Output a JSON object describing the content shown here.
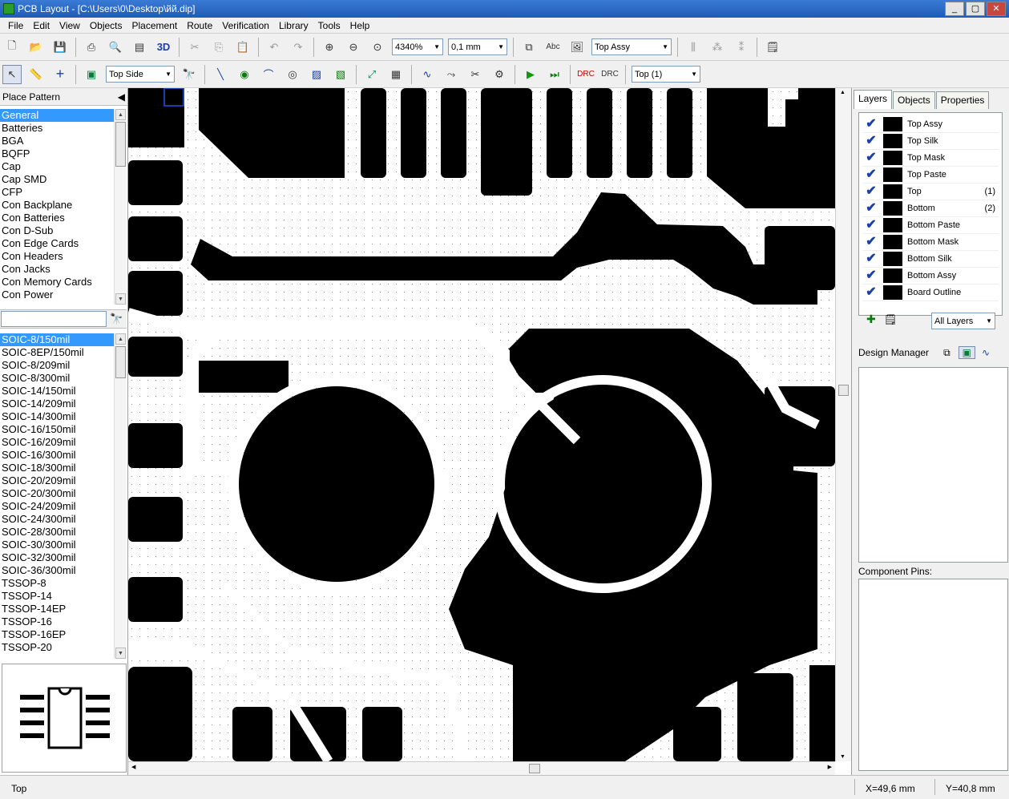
{
  "window": {
    "title": "PCB Layout - [C:\\Users\\0\\Desktop\\йй.dip]"
  },
  "menu": [
    "File",
    "Edit",
    "View",
    "Objects",
    "Placement",
    "Route",
    "Verification",
    "Library",
    "Tools",
    "Help"
  ],
  "toolbar1": {
    "zoom": "4340%",
    "grid": "0,1 mm",
    "view_layer": "Top Assy",
    "btn_3d": "3D"
  },
  "toolbar2": {
    "side": "Top Side",
    "route_layer": "Top (1)"
  },
  "left_panel": {
    "header": "Place Pattern",
    "categories": [
      "General",
      "Batteries",
      "BGA",
      "BQFP",
      "Cap",
      "Cap SMD",
      "CFP",
      "Con Backplane",
      "Con Batteries",
      "Con D-Sub",
      "Con Edge Cards",
      "Con Headers",
      "Con Jacks",
      "Con Memory Cards",
      "Con Power"
    ],
    "selected_category": 0,
    "search_value": "",
    "patterns": [
      "SOIC-8/150mil",
      "SOIC-8EP/150mil",
      "SOIC-8/209mil",
      "SOIC-8/300mil",
      "SOIC-14/150mil",
      "SOIC-14/209mil",
      "SOIC-14/300mil",
      "SOIC-16/150mil",
      "SOIC-16/209mil",
      "SOIC-16/300mil",
      "SOIC-18/300mil",
      "SOIC-20/209mil",
      "SOIC-20/300mil",
      "SOIC-24/209mil",
      "SOIC-24/300mil",
      "SOIC-28/300mil",
      "SOIC-30/300mil",
      "SOIC-32/300mil",
      "SOIC-36/300mil",
      "TSSOP-8",
      "TSSOP-14",
      "TSSOP-14EP",
      "TSSOP-16",
      "TSSOP-16EP",
      "TSSOP-20"
    ],
    "selected_pattern": 0
  },
  "right_panel": {
    "tabs": [
      "Layers",
      "Objects",
      "Properties"
    ],
    "active_tab": 0,
    "layers": [
      {
        "name": "Top Assy",
        "num": ""
      },
      {
        "name": "Top Silk",
        "num": ""
      },
      {
        "name": "Top Mask",
        "num": ""
      },
      {
        "name": "Top Paste",
        "num": ""
      },
      {
        "name": "Top",
        "num": "(1)"
      },
      {
        "name": "Bottom",
        "num": "(2)"
      },
      {
        "name": "Bottom Paste",
        "num": ""
      },
      {
        "name": "Bottom Mask",
        "num": ""
      },
      {
        "name": "Bottom Silk",
        "num": ""
      },
      {
        "name": "Bottom Assy",
        "num": ""
      },
      {
        "name": "Board Outline",
        "num": ""
      }
    ],
    "layer_filter": "All Layers",
    "design_manager": "Design Manager",
    "component_pins": "Component Pins:"
  },
  "status": {
    "layer": "Top",
    "x": "X=49,6 mm",
    "y": "Y=40,8 mm"
  },
  "colors": {
    "copper": "#000000",
    "board": "#ffffff",
    "selection": "#3399ff",
    "check": "#1a3fa8"
  }
}
